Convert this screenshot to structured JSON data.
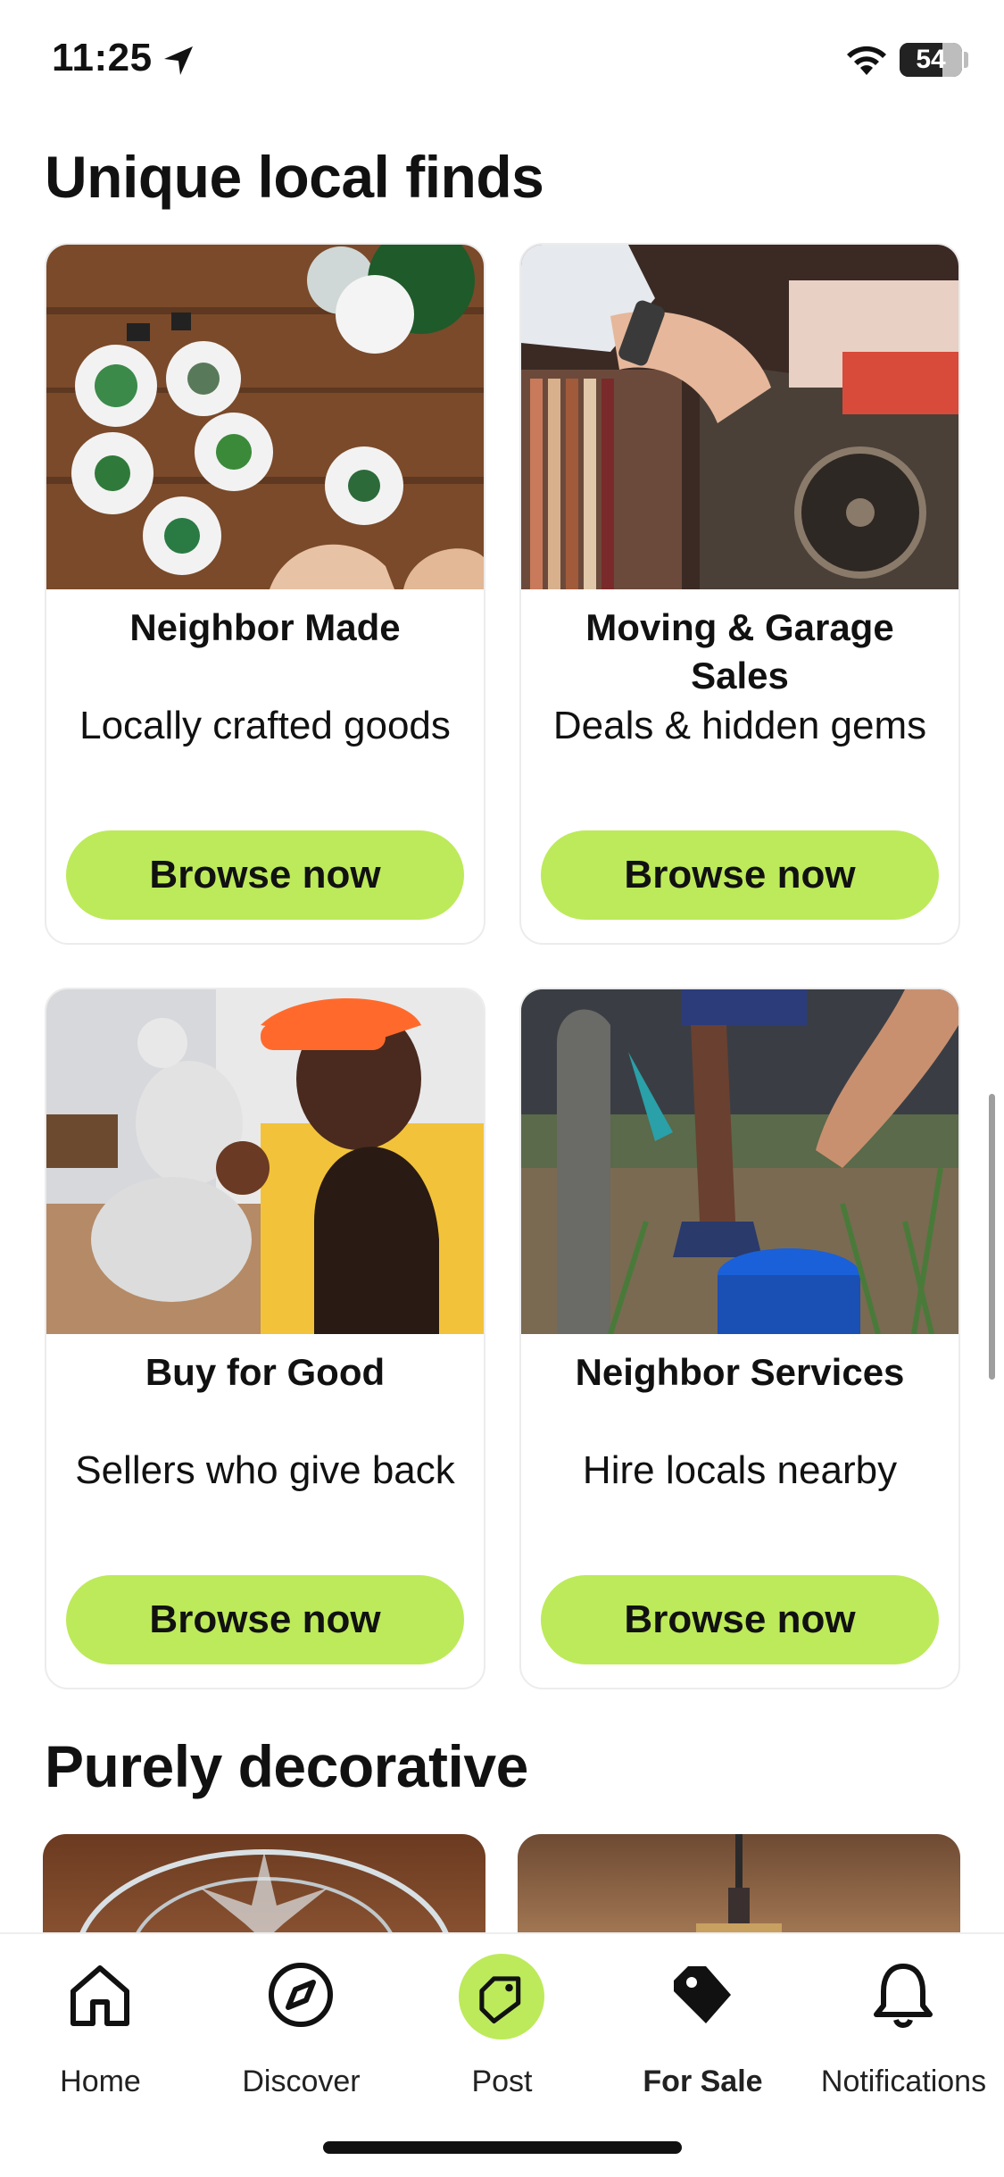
{
  "status_bar": {
    "time": "11:25",
    "battery": "54"
  },
  "sections": {
    "local_finds_title": "Unique local finds",
    "decorative_title": "Purely decorative"
  },
  "cards": [
    {
      "title": "Neighbor Made",
      "subtitle": "Locally crafted goods",
      "button": "Browse now"
    },
    {
      "title": "Moving & Garage Sales",
      "subtitle": "Deals & hidden gems",
      "button": "Browse now"
    },
    {
      "title": "Buy for Good",
      "subtitle": "Sellers who give back",
      "button": "Browse now"
    },
    {
      "title": "Neighbor Services",
      "subtitle": "Hire locals nearby",
      "button": "Browse now"
    }
  ],
  "tabbar": {
    "items": [
      {
        "label": "Home",
        "icon": "home-icon"
      },
      {
        "label": "Discover",
        "icon": "compass-icon"
      },
      {
        "label": "Post",
        "icon": "post-tag-icon"
      },
      {
        "label": "For Sale",
        "icon": "price-tag-icon"
      },
      {
        "label": "Notifications",
        "icon": "bell-icon"
      }
    ],
    "active": "For Sale"
  },
  "colors": {
    "accent": "#bdea5a",
    "text": "#111111"
  }
}
